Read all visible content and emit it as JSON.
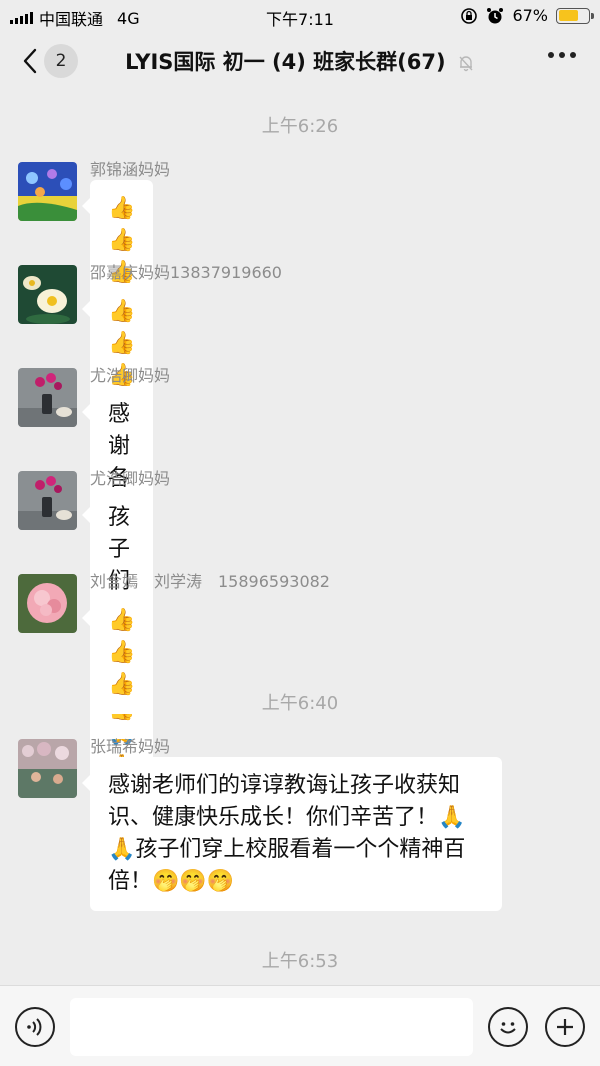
{
  "status_bar": {
    "carrier": "中国联通",
    "network": "4G",
    "time": "下午7:11",
    "battery_percent": "67%",
    "battery_level": 0.67
  },
  "nav": {
    "back_badge": "2",
    "title": "LYIS国际 初一 (4) 班家长群(67)",
    "icons": [
      "back-chevron-icon",
      "mute-bell-icon",
      "more-dots-icon"
    ]
  },
  "timestamps": [
    "上午6:26",
    "上午6:40",
    "上午6:53"
  ],
  "messages": [
    {
      "sender": "郭锦涵妈妈",
      "text": "👍👍👍",
      "avatar": "flowers-photo"
    },
    {
      "sender": "邵嘉庆妈妈13837919660",
      "text": "👍👍👍",
      "avatar": "lotus-photo"
    },
    {
      "sender": "尤浩卿妈妈",
      "text": "感谢各位老师🌹🌹🌹🙏🙏🙏",
      "avatar": "vase-flower-photo"
    },
    {
      "sender": "尤浩卿妈妈",
      "text": "孩子们都👍👍👍",
      "avatar": "vase-flower-photo"
    },
    {
      "sender": "刘含嫣　刘学涛　15896593082",
      "text": "👍👍👍",
      "avatar": "pink-flower-photo"
    },
    {
      "sender": "张瑞希妈妈",
      "text": "感谢老师们的谆谆教诲让孩子收获知识、健康快乐成长！你们辛苦了！🙏🙏孩子们穿上校服看着一个个精神百倍！🤭🤭🤭",
      "avatar": "crowd-photo"
    }
  ],
  "input_bar": {
    "icons": [
      "voice-icon",
      "emoji-icon",
      "plus-icon"
    ]
  }
}
